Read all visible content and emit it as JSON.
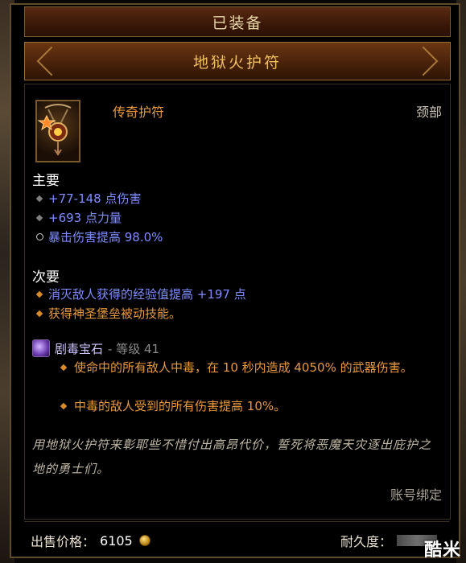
{
  "tooltip": {
    "header_label": "已装备",
    "item_name": "地狱火护符",
    "item_type": "传奇护符",
    "item_slot": "颈部",
    "primary": {
      "title": "主要",
      "stats": [
        {
          "text": "+77-148 点伤害",
          "bullet": "gray-diamond"
        },
        {
          "text": "+693 点力量",
          "bullet": "gray-diamond"
        },
        {
          "text": "暴击伤害提高 98.0%",
          "bullet": "open-circle"
        }
      ]
    },
    "secondary": {
      "title": "次要",
      "stats": [
        {
          "text": "消灭敌人获得的经验值提高 +197 点",
          "bullet": "orange-diamond"
        },
        {
          "text": "获得神圣堡垒被动技能。",
          "bullet": "orange-diamond"
        }
      ]
    },
    "gem": {
      "name": "剧毒宝石",
      "level_text": "- 等级 41",
      "effects": [
        "使命中的所有敌人中毒，在 10 秒内造成 4050% 的武器伤害。",
        "中毒的敌人受到的所有伤害提高 10%。"
      ]
    },
    "flavor_text": "用地狱火护符来彰耶些不惜付出高昂代价，誓死将恶魔天灾逐出庇护之地的勇士们。",
    "bind_text": "账号绑定",
    "price_label": "出售价格：",
    "price_value": "6105",
    "durability_label": "耐久度："
  },
  "watermark": "酷米",
  "colors": {
    "legendary_orange": "#e89a3c",
    "magic_blue": "#7f8cff",
    "gold_title": "#f0c061"
  },
  "icons": {
    "item": "amulet-icon",
    "gem": "poison-gem-icon",
    "coin": "gold-coin-icon"
  }
}
